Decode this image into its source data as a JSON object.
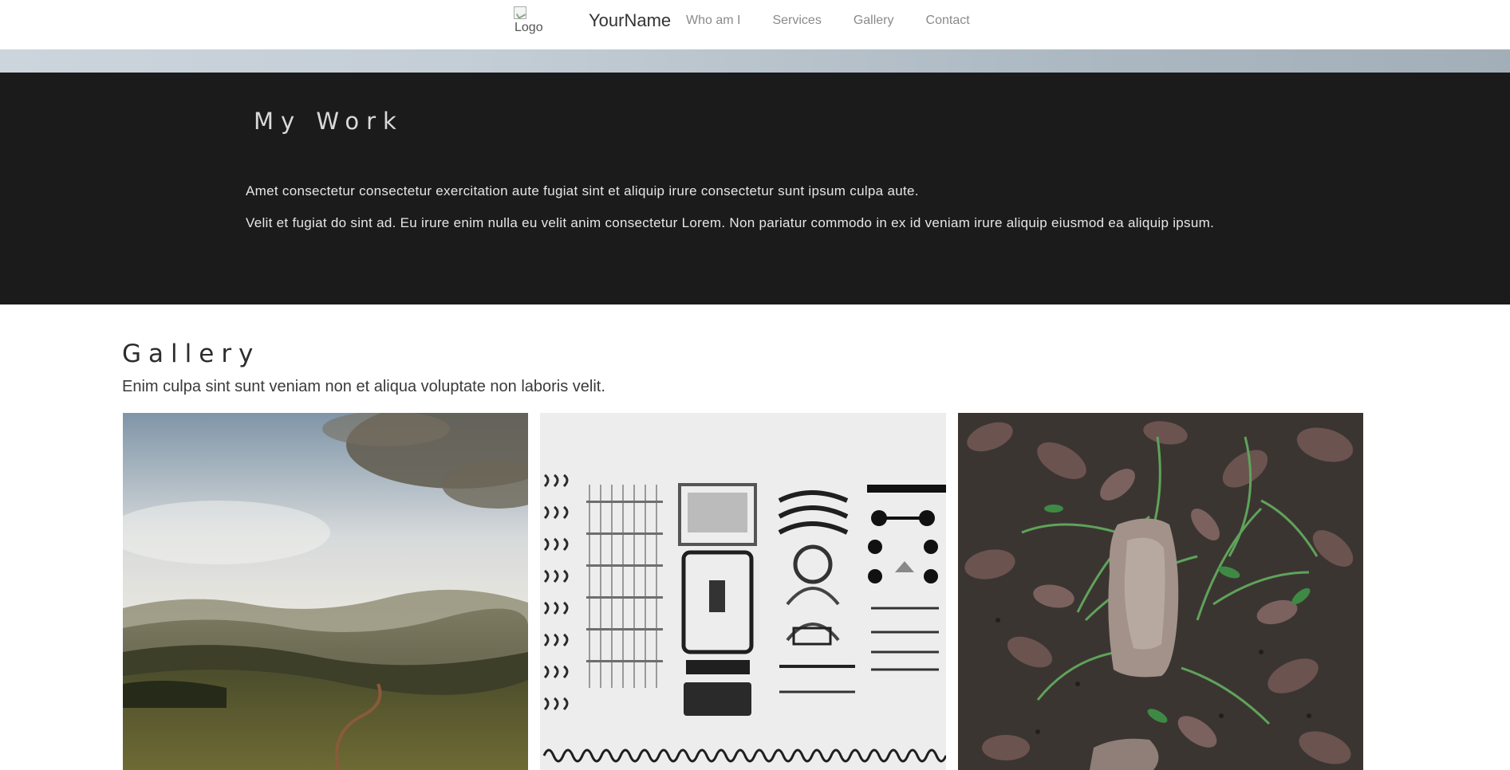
{
  "header": {
    "logo_alt": "Logo",
    "brand_name": "YourName",
    "nav": [
      "Who am I",
      "Services",
      "Gallery",
      "Contact"
    ]
  },
  "mywork": {
    "title": "My Work",
    "paragraphs": [
      "Amet consectetur consectetur exercitation aute fugiat sint et aliquip irure consectetur sunt ipsum culpa aute.",
      "Velit et fugiat do sint ad. Eu irure enim nulla eu velit anim consectetur Lorem. Non pariatur commodo in ex id veniam irure aliquip eiusmod ea aliquip ipsum."
    ]
  },
  "gallery": {
    "title": "Gallery",
    "subtitle": "Enim culpa sint sunt veniam non et aliqua voluptate non laboris velit."
  },
  "colors": {
    "dark_section": "#1b1b1b",
    "nav_text": "#8a8a8a",
    "band_start": "#ccd4dc",
    "band_end": "#a3afb8"
  }
}
